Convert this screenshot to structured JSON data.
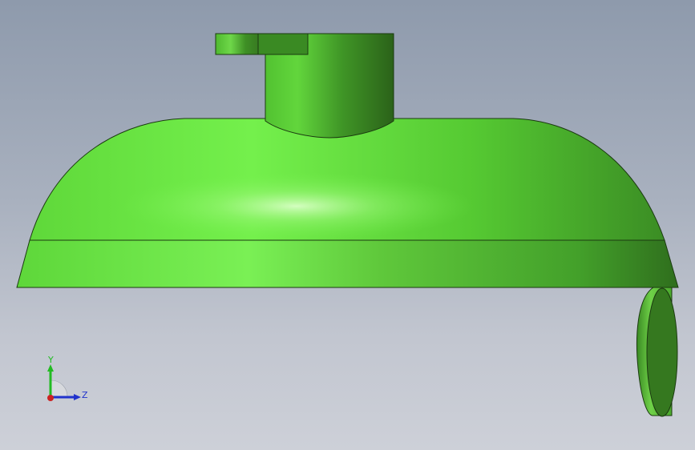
{
  "viewport": {
    "background_top": "#8e9aac",
    "background_bottom": "#cdd0d8",
    "model_color": "#5fdc3c"
  },
  "triad": {
    "y_label": "Y",
    "z_label": "Z",
    "y_color": "#22bb22",
    "z_color": "#2233cc",
    "x_color": "#cc2222"
  }
}
